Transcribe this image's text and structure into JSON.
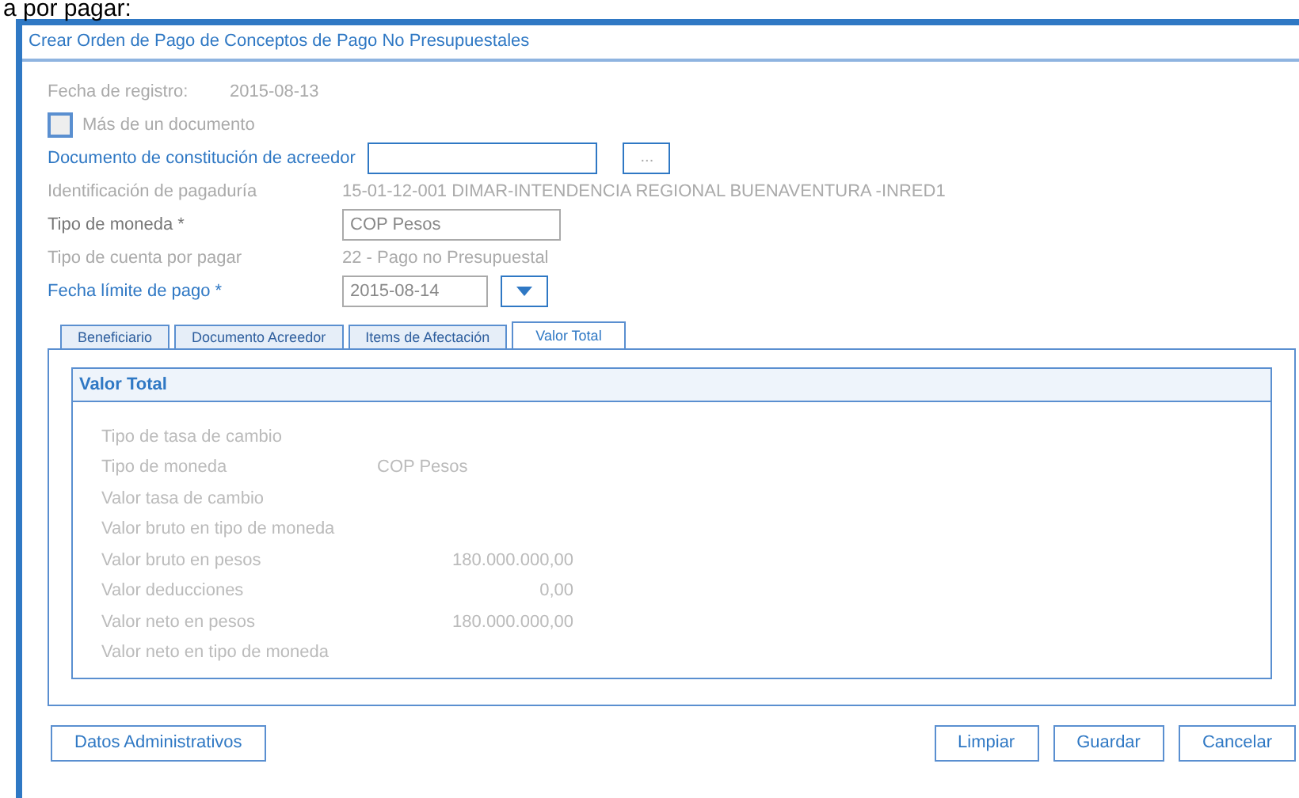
{
  "page_caption": "a por pagar:",
  "window": {
    "title": "Crear Orden de Pago de Conceptos de Pago No Presupuestales"
  },
  "fields": [
    {
      "kind": "text",
      "label": "Fecha de registro:",
      "value": "2015-08-13"
    },
    {
      "kind": "checkbox",
      "label": "Más de un documento",
      "checked": false
    },
    {
      "kind": "lookup",
      "label": "Documento de constitución de acreedor",
      "button": "..."
    },
    {
      "kind": "text",
      "label": "Identificación de pagaduría",
      "value": "15-01-12-001 DIMAR-INTENDENCIA REGIONAL BUENAVENTURA -INRED1"
    },
    {
      "kind": "input",
      "label": "Tipo de moneda *",
      "value": "COP Pesos"
    },
    {
      "kind": "text",
      "label": "Tipo de cuenta por pagar",
      "value": "22 - Pago no Presupuestal"
    },
    {
      "kind": "date",
      "label": "Fecha límite de pago *",
      "value": "2015-08-14"
    }
  ],
  "tabs": [
    {
      "label": "Beneficiario",
      "selected": false
    },
    {
      "label": "Documento Acreedor",
      "selected": false
    },
    {
      "label": "Items de Afectación",
      "selected": false
    },
    {
      "label": "Valor Total",
      "selected": true
    }
  ],
  "panel": {
    "title": "Valor Total",
    "rows": [
      {
        "label": "Tipo de tasa de cambio"
      },
      {
        "label": "Tipo de moneda",
        "value": "COP Pesos",
        "kind": "text"
      },
      {
        "label": "Valor tasa de cambio"
      },
      {
        "label": "Valor bruto en tipo de moneda"
      },
      {
        "label": "Valor bruto en pesos",
        "value": "180.000.000,00",
        "kind": "amount"
      },
      {
        "label": "Valor deducciones",
        "value": "0,00",
        "kind": "amount"
      },
      {
        "label": "Valor neto en pesos",
        "value": "180.000.000,00",
        "kind": "amount"
      },
      {
        "label": "Valor neto en tipo de moneda"
      }
    ]
  },
  "buttons_left": [
    "Datos Administrativos"
  ],
  "buttons_right": [
    "Limpiar",
    "Guardar",
    "Cancelar"
  ]
}
